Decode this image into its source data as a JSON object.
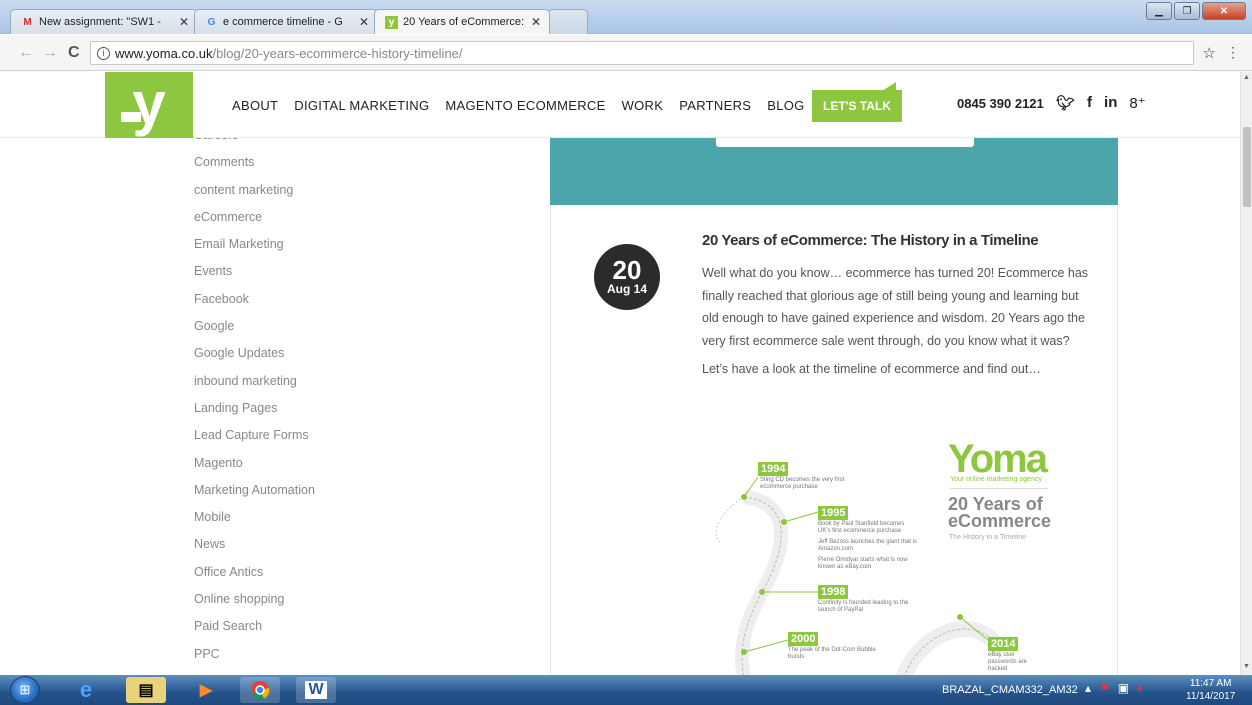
{
  "browser": {
    "tabs": [
      {
        "label": "New assignment: \"SW1 -",
        "favicon": "gmail-icon"
      },
      {
        "label": "e commerce timeline - G",
        "favicon": "google-icon"
      },
      {
        "label": "20 Years of eCommerce:",
        "favicon": "yoma-icon"
      }
    ],
    "url_domain": "www.yoma.co.uk",
    "url_path": "/blog/20-years-ecommerce-history-timeline/",
    "window_controls": [
      "minimize",
      "restore",
      "close"
    ]
  },
  "site": {
    "logo": "y",
    "nav": [
      "ABOUT",
      "DIGITAL MARKETING",
      "MAGENTO ECOMMERCE",
      "WORK",
      "PARTNERS",
      "BLOG"
    ],
    "cta": "LET'S TALK",
    "phone": "0845 390 2121",
    "social": [
      "twitter-icon",
      "facebook-icon",
      "linkedin-icon",
      "google-plus-icon"
    ]
  },
  "sidebar": {
    "categories": [
      "Careers",
      "Comments",
      "content marketing",
      "eCommerce",
      "Email Marketing",
      "Events",
      "Facebook",
      "Google",
      "Google Updates",
      "inbound marketing",
      "Landing Pages",
      "Lead Capture Forms",
      "Magento",
      "Marketing Automation",
      "Mobile",
      "News",
      "Office Antics",
      "Online shopping",
      "Paid Search",
      "PPC"
    ]
  },
  "post": {
    "date_day": "20",
    "date_month": "Aug 14",
    "title": "20 Years of eCommerce: The History in a Timeline",
    "paragraph1": "Well what do you know… ecommerce has turned 20! Ecommerce has finally reached that glorious age of still being young and learning but old enough to have gained experience and wisdom. 20 Years ago the very first ecommerce sale went through, do you know what it was?",
    "paragraph2": "Let’s have a look at the timeline of ecommerce and find out…"
  },
  "infographic": {
    "brand": "Yoma",
    "brand_tagline": "Your online marketing agency",
    "heading_line1": "20 Years of",
    "heading_line2": "eCommerce",
    "subheading": "The History in a Timeline",
    "events": [
      {
        "year": "1994",
        "text": "Sting CD becomes the very first ecommerce purchase"
      },
      {
        "year": "1995",
        "text": "Book by Paul Stanfield becomes UK's first ecommerce purchase"
      },
      {
        "year": "1995b",
        "text": "Jeff Bezoss launches the giant that is Amazon.com"
      },
      {
        "year": "1995c",
        "text": "Pierre Omidyar starts what is now known as eBay.com"
      },
      {
        "year": "1998",
        "text": "Confinity is founded leading to the launch of PayPal"
      },
      {
        "year": "2000",
        "text": "The peak of the Dot-Com Bubble bursts"
      },
      {
        "year": "2014",
        "text": "eBay user passwords are hacked"
      }
    ]
  },
  "taskbar": {
    "tray_label": "BRAZAL_CMAM332_AM32",
    "time": "11:47 AM",
    "date": "11/14/2017"
  },
  "colors": {
    "brand_green": "#8dc63f",
    "teal": "#4ba6ab",
    "date_badge": "#2b2b2b"
  }
}
